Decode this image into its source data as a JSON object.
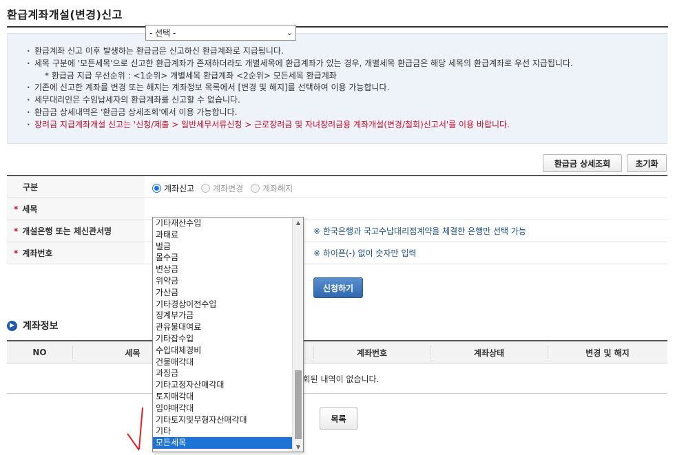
{
  "page": {
    "title": "환급계좌개설(변경)신고"
  },
  "notice": {
    "lines": [
      "환급계좌 신고 이후 발생하는 환급금은 신고하신 환급계좌로 지급됩니다.",
      "세목 구분에 '모든세목'으로 신고한 환급계좌가 존재하더라도 개별세목에 환급계좌가 있는 경우, 개별세목 환급금은 해당 세목의 환급계좌로 우선 지급됩니다.",
      "* 환급금 지급 우선순위 : <1순위> 개별세목 환급계좌   <2순위> 모든세목 환급계좌",
      "기존에 신고한 계좌를 변경 또는 해지는 계좌정보 목록에서 [변경 및 해지]를 선택하여 이용 가능합니다.",
      "세무대리인은 수임납세자의 환급계좌를 신고할 수 없습니다.",
      "환급금 상세내역은 '환급금 상세조회'에서 이용 가능합니다.",
      "장려금 지급계좌개설 신고는 '신청/제출 > 일반세무서류신청 > 근로장려금 및 자녀장려금용 계좌개설(변경/철회)신고서'를 이용 바랍니다."
    ]
  },
  "actions": {
    "refund_detail_label": "환급금 상세조회",
    "reset_label": "초기화",
    "apply_label": "신청하기",
    "list_label": "목록"
  },
  "form": {
    "type_label": "구분",
    "radios": [
      "계좌신고",
      "계좌변경",
      "계좌해지"
    ],
    "tax_label": "세목",
    "tax_selected": "- 선택 -",
    "bank_label": "개설은행 또는 체신관서명",
    "bank_hint": "※ 한국은행과 국고수납대리점계약을 체결한 은행만 선택 가능",
    "account_label": "계좌번호",
    "account_hint": "※ 하이픈(-) 없이 숫자만 입력"
  },
  "dropdown": {
    "options": [
      "기타재산수입",
      "과태료",
      "벌금",
      "몰수금",
      "변상금",
      "위약금",
      "가산금",
      "기타경상이전수입",
      "징계부가금",
      "관유물대여료",
      "기타잡수입",
      "수입대체경비",
      "건물매각대",
      "과징금",
      "기타고정자산매각대",
      "토지매각대",
      "임야매각대",
      "기타토지및무형자산매각대",
      "기타",
      "모든세목"
    ],
    "highlighted": "모든세목"
  },
  "account_info": {
    "title": "계좌정보",
    "columns": [
      "NO",
      "세목",
      "계좌번호",
      "계좌상태",
      "변경 및 해지"
    ],
    "empty_message": "조회된 내역이 없습니다."
  },
  "colors": {
    "accent_blue": "#1e74d6",
    "notice_bg": "#eef3f9",
    "warning_red": "#c8102e",
    "annotation_red": "#e02020"
  }
}
